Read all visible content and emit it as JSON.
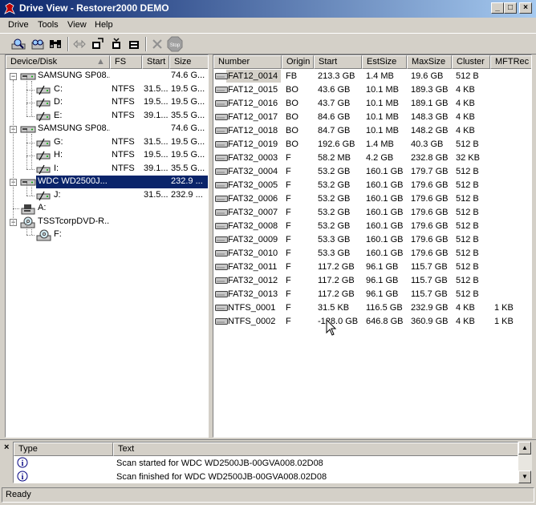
{
  "window": {
    "title": "Drive View - Restorer2000 DEMO",
    "controls": {
      "minimize": "_",
      "maximize": "□",
      "close": "×"
    }
  },
  "menu": [
    "Drive",
    "Tools",
    "View",
    "Help"
  ],
  "toolbar": {
    "icons": [
      "scan-icon",
      "open-icon",
      "binoculars-icon",
      "swap-icon",
      "export-icon",
      "save-icon",
      "save-all-icon",
      "delete-icon",
      "stop-icon"
    ],
    "stop_label": "Stop"
  },
  "device_tree": {
    "columns": [
      "Device/Disk",
      "FS",
      "Start",
      "Size"
    ],
    "rows": [
      {
        "level": 0,
        "name": "SAMSUNG SP08...",
        "fs": "",
        "start": "",
        "size": "74.6 G...",
        "icon": "hard-drive-icon"
      },
      {
        "level": 1,
        "name": "C:",
        "fs": "NTFS",
        "start": "31.5...",
        "size": "19.5 G...",
        "icon": "partition-icon"
      },
      {
        "level": 1,
        "name": "D:",
        "fs": "NTFS",
        "start": "19.5...",
        "size": "19.5 G...",
        "icon": "partition-icon"
      },
      {
        "level": 1,
        "name": "E:",
        "fs": "NTFS",
        "start": "39.1...",
        "size": "35.5 G...",
        "icon": "partition-icon"
      },
      {
        "level": 0,
        "name": "SAMSUNG SP08...",
        "fs": "",
        "start": "",
        "size": "74.6 G...",
        "icon": "hard-drive-icon"
      },
      {
        "level": 1,
        "name": "G:",
        "fs": "NTFS",
        "start": "31.5...",
        "size": "19.5 G...",
        "icon": "partition-icon"
      },
      {
        "level": 1,
        "name": "H:",
        "fs": "NTFS",
        "start": "19.5...",
        "size": "19.5 G...",
        "icon": "partition-icon"
      },
      {
        "level": 1,
        "name": "I:",
        "fs": "NTFS",
        "start": "39.1...",
        "size": "35.5 G...",
        "icon": "partition-icon"
      },
      {
        "level": 0,
        "name": "WDC WD2500J...",
        "fs": "",
        "start": "",
        "size": "232.9 ...",
        "icon": "hard-drive-icon",
        "selected": true
      },
      {
        "level": 1,
        "name": "J:",
        "fs": "",
        "start": "31.5...",
        "size": "232.9 ...",
        "icon": "partition-icon"
      },
      {
        "level": 0,
        "name": "A:",
        "fs": "",
        "start": "",
        "size": "",
        "icon": "floppy-drive-icon"
      },
      {
        "level": 0,
        "name": "TSSTcorpDVD-R...",
        "fs": "",
        "start": "",
        "size": "",
        "icon": "cd-drive-icon"
      },
      {
        "level": 1,
        "name": "F:",
        "fs": "",
        "start": "",
        "size": "",
        "icon": "cd-disc-icon"
      }
    ]
  },
  "partition_list": {
    "columns": [
      "Number",
      "Origin",
      "Start",
      "EstSize",
      "MaxSize",
      "Cluster",
      "MFTRec"
    ],
    "rows": [
      [
        "FAT12_0014",
        "FB",
        "213.3 GB",
        "1.4 MB",
        "19.6 GB",
        "512 B",
        ""
      ],
      [
        "FAT12_0015",
        "BO",
        "43.6 GB",
        "10.1 MB",
        "189.3 GB",
        "4 KB",
        ""
      ],
      [
        "FAT12_0016",
        "BO",
        "43.7 GB",
        "10.1 MB",
        "189.1 GB",
        "4 KB",
        ""
      ],
      [
        "FAT12_0017",
        "BO",
        "84.6 GB",
        "10.1 MB",
        "148.3 GB",
        "4 KB",
        ""
      ],
      [
        "FAT12_0018",
        "BO",
        "84.7 GB",
        "10.1 MB",
        "148.2 GB",
        "4 KB",
        ""
      ],
      [
        "FAT12_0019",
        "BO",
        "192.6 GB",
        "1.4 MB",
        "40.3 GB",
        "512 B",
        ""
      ],
      [
        "FAT32_0003",
        "F",
        "58.2 MB",
        "4.2 GB",
        "232.8 GB",
        "32 KB",
        ""
      ],
      [
        "FAT32_0004",
        "F",
        "53.2 GB",
        "160.1 GB",
        "179.7 GB",
        "512 B",
        ""
      ],
      [
        "FAT32_0005",
        "F",
        "53.2 GB",
        "160.1 GB",
        "179.6 GB",
        "512 B",
        ""
      ],
      [
        "FAT32_0006",
        "F",
        "53.2 GB",
        "160.1 GB",
        "179.6 GB",
        "512 B",
        ""
      ],
      [
        "FAT32_0007",
        "F",
        "53.2 GB",
        "160.1 GB",
        "179.6 GB",
        "512 B",
        ""
      ],
      [
        "FAT32_0008",
        "F",
        "53.2 GB",
        "160.1 GB",
        "179.6 GB",
        "512 B",
        ""
      ],
      [
        "FAT32_0009",
        "F",
        "53.3 GB",
        "160.1 GB",
        "179.6 GB",
        "512 B",
        ""
      ],
      [
        "FAT32_0010",
        "F",
        "53.3 GB",
        "160.1 GB",
        "179.6 GB",
        "512 B",
        ""
      ],
      [
        "FAT32_0011",
        "F",
        "117.2 GB",
        "96.1 GB",
        "115.7 GB",
        "512 B",
        ""
      ],
      [
        "FAT32_0012",
        "F",
        "117.2 GB",
        "96.1 GB",
        "115.7 GB",
        "512 B",
        ""
      ],
      [
        "FAT32_0013",
        "F",
        "117.2 GB",
        "96.1 GB",
        "115.7 GB",
        "512 B",
        ""
      ],
      [
        "NTFS_0001",
        "F",
        "31.5 KB",
        "116.5 GB",
        "232.9 GB",
        "4 KB",
        "1 KB"
      ],
      [
        "NTFS_0002",
        "F",
        "-128.0 GB",
        "646.8 GB",
        "360.9 GB",
        "4 KB",
        "1 KB"
      ]
    ]
  },
  "log": {
    "columns": [
      "Type",
      "Text"
    ],
    "rows": [
      {
        "type_icon": "info-icon",
        "text": "Scan started for WDC WD2500JB-00GVA008.02D08"
      },
      {
        "type_icon": "info-icon",
        "text": "Scan finished for WDC WD2500JB-00GVA008.02D08"
      }
    ]
  },
  "status": {
    "text": "Ready"
  },
  "colors": {
    "title_start": "#0a246a",
    "title_end": "#a6caf0",
    "selection": "#0a246a",
    "face": "#d4d0c8"
  }
}
